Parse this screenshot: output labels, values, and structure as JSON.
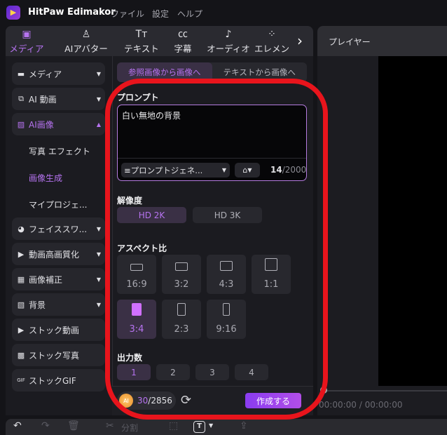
{
  "app": {
    "title": "HitPaw Edimakor",
    "menus": [
      "ファイル",
      "設定",
      "ヘルプ"
    ]
  },
  "top_tabs": [
    {
      "label": "メディア",
      "icon": "media-icon",
      "active": true
    },
    {
      "label": "AIアバター",
      "icon": "avatar-icon"
    },
    {
      "label": "テキスト",
      "icon": "text-icon"
    },
    {
      "label": "字幕",
      "icon": "caption-icon"
    },
    {
      "label": "オーディオ",
      "icon": "audio-icon"
    },
    {
      "label": "エレメン",
      "icon": "element-icon"
    }
  ],
  "sidebar": {
    "items": [
      {
        "label": "メディア",
        "icon": "folder-icon"
      },
      {
        "label": "AI 動画",
        "icon": "ai-video-icon"
      },
      {
        "label": "AI画像",
        "icon": "ai-image-icon",
        "active": true
      }
    ],
    "subitems": [
      {
        "label": "写真 エフェクト"
      },
      {
        "label": "画像生成",
        "active": true
      },
      {
        "label": "マイプロジェ..."
      }
    ],
    "items2": [
      {
        "label": "フェイススワ...",
        "icon": "face-swap-icon"
      },
      {
        "label": "動画高画質化",
        "icon": "video-enhance-icon"
      },
      {
        "label": "画像補正",
        "icon": "image-enhance-icon"
      },
      {
        "label": "背景",
        "icon": "background-icon"
      },
      {
        "label": "ストック動画",
        "icon": "stock-video-icon"
      },
      {
        "label": "ストック写真",
        "icon": "stock-photo-icon"
      },
      {
        "label": "ストックGIF",
        "icon": "stock-gif-icon"
      }
    ]
  },
  "content": {
    "subtabs": [
      "参照画像から画像へ",
      "テキストから画像へ"
    ],
    "prompt_label": "プロンプト",
    "prompt_value": "白い無地の背景",
    "prompt_generator": "プロンプトジェネ...",
    "char_count": "14",
    "char_max": "/2000",
    "resolution_label": "解像度",
    "resolutions": [
      "HD 2K",
      "HD 3K"
    ],
    "aspect_label": "アスペクト比",
    "aspects": [
      "16:9",
      "3:2",
      "4:3",
      "1:1",
      "3:4",
      "2:3",
      "9:16"
    ],
    "output_label": "出力数",
    "outputs": [
      "1",
      "2",
      "3",
      "4"
    ],
    "credits_used": "30",
    "credits_total": "/2856",
    "ai_badge": "AI",
    "create": "作成する"
  },
  "player": {
    "title": "プレイヤー",
    "time": "00:00:00 / 00:00:00"
  },
  "toolbar": {
    "split": "分割",
    "text_tool": "T"
  },
  "colors": {
    "accent": "#b673f0",
    "annotation": "#e8141c"
  }
}
